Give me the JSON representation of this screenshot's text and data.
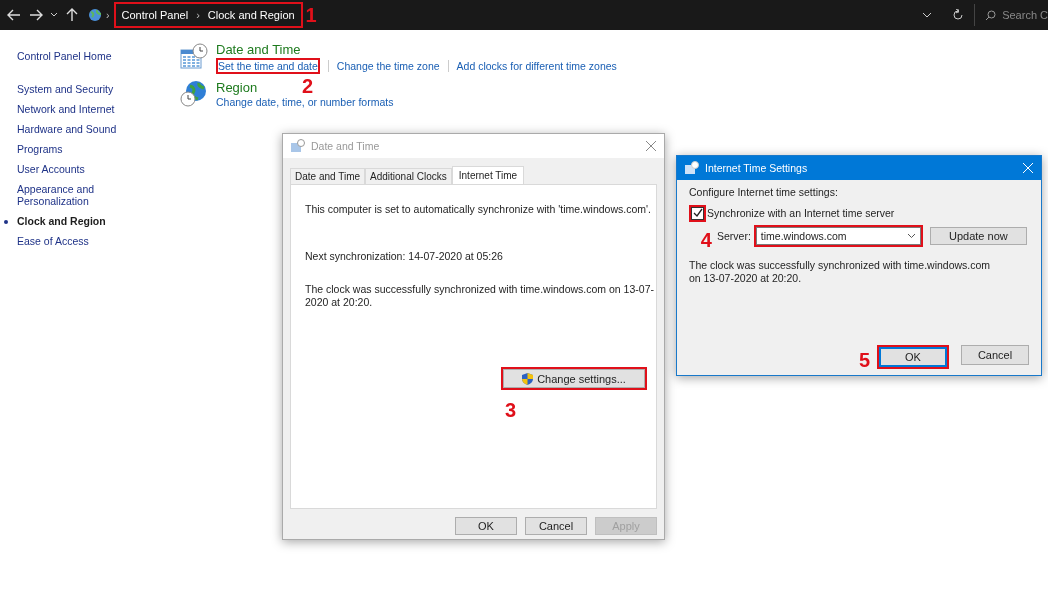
{
  "address_bar": {
    "breadcrumb": [
      "Control Panel",
      "Clock and Region"
    ],
    "separator": "›",
    "highlighted": true,
    "step": "1",
    "search": {
      "placeholder": "Search C"
    }
  },
  "sidebar": {
    "items": [
      {
        "label": "Control Panel Home",
        "selected": false
      },
      {
        "label": "System and Security",
        "selected": false
      },
      {
        "label": "Network and Internet",
        "selected": false
      },
      {
        "label": "Hardware and Sound",
        "selected": false
      },
      {
        "label": "Programs",
        "selected": false
      },
      {
        "label": "User Accounts",
        "selected": false
      },
      {
        "label": "Appearance and Personalization",
        "selected": false
      },
      {
        "label": "Clock and Region",
        "selected": true
      },
      {
        "label": "Ease of Access",
        "selected": false
      }
    ]
  },
  "categories": [
    {
      "kind": "clock",
      "title": "Date and Time",
      "links": [
        {
          "label": "Set the time and date",
          "highlighted": true,
          "step": "2"
        },
        {
          "label": "Change the time zone",
          "highlighted": false
        },
        {
          "label": "Add clocks for different time zones",
          "highlighted": false
        }
      ]
    },
    {
      "kind": "globe",
      "title": "Region",
      "links": [
        {
          "label": "Change date, time, or number formats",
          "highlighted": false
        }
      ]
    }
  ],
  "date_time_dialog": {
    "title": "Date and Time",
    "tabs": [
      {
        "label": "Date and Time",
        "selected": false
      },
      {
        "label": "Additional Clocks",
        "selected": false
      },
      {
        "label": "Internet Time",
        "selected": true
      }
    ],
    "messages": [
      "This computer is set to automatically synchronize with 'time.windows.com'.",
      "Next synchronization: 14-07-2020 at 05:26",
      "The clock was successfully synchronized with time.windows.com on 13-07-2020 at 20:20."
    ],
    "change_settings_button": {
      "label": "Change settings...",
      "highlighted": true,
      "step": "3"
    },
    "buttons": [
      {
        "label": "OK",
        "disabled": false
      },
      {
        "label": "Cancel",
        "disabled": false
      },
      {
        "label": "Apply",
        "disabled": true
      }
    ]
  },
  "internet_time_dialog": {
    "title": "Internet Time Settings",
    "heading": "Configure Internet time settings:",
    "sync_checkbox": {
      "label": "Synchronize with an Internet time server",
      "checked": true,
      "highlighted": true
    },
    "server": {
      "label": "Server:",
      "value": "time.windows.com",
      "highlighted": true,
      "step": "4"
    },
    "update_button": "Update now",
    "status": "The clock was successfully synchronized with time.windows.com on 13-07-2020 at 20:20.",
    "buttons": [
      {
        "label": "OK",
        "default": true,
        "highlighted": true,
        "step": "5"
      },
      {
        "label": "Cancel",
        "default": false,
        "highlighted": false
      }
    ]
  }
}
